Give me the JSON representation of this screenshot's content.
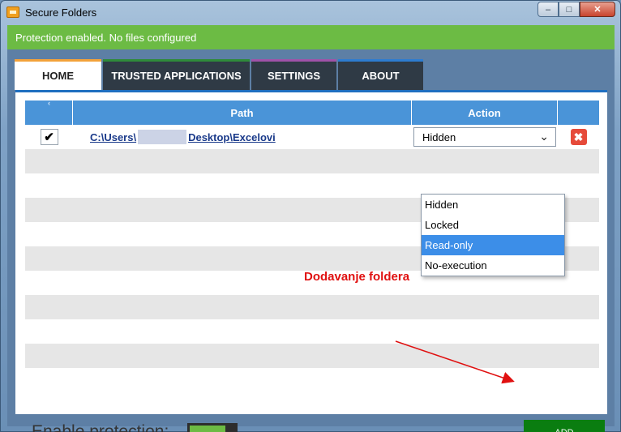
{
  "window": {
    "title": "Secure Folders"
  },
  "banner": {
    "text": "Protection enabled. No files configured"
  },
  "tabs": [
    {
      "label": "HOME"
    },
    {
      "label": "TRUSTED APPLICATIONS"
    },
    {
      "label": "SETTINGS"
    },
    {
      "label": "ABOUT"
    }
  ],
  "table": {
    "headers": {
      "path": "Path",
      "action": "Action"
    },
    "rows": [
      {
        "checked": "✔",
        "path_prefix": "C:\\Users\\",
        "path_suffix": "Desktop\\Excelovi",
        "action": "Hidden"
      }
    ]
  },
  "dropdown": {
    "options": [
      "Hidden",
      "Locked",
      "Read-only",
      "No-execution"
    ],
    "highlighted": "Read-only"
  },
  "bottom": {
    "enable_label": "Enable protection:",
    "add_label": "ADD"
  },
  "annotation": {
    "text": "Dodavanje foldera"
  },
  "colors": {
    "banner": "#6cbb44",
    "header": "#4a94d8",
    "add_button": "#0a7d10",
    "annotation": "#e01010"
  }
}
